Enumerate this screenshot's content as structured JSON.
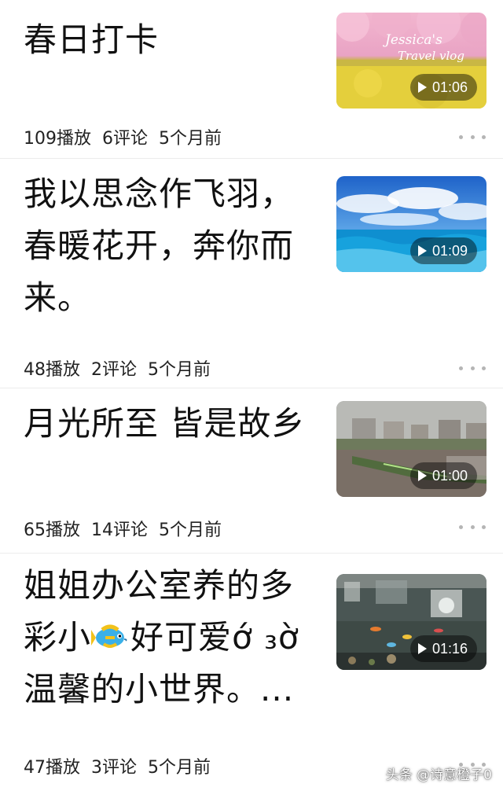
{
  "feed": {
    "items": [
      {
        "title": "春日打卡",
        "duration": "01:06",
        "plays": "109播放",
        "comments": "6评论",
        "time": "5个月前",
        "thumb_caption": "Jessica's Travel vlog"
      },
      {
        "title": "我以思念作飞羽，春暖花开，奔你而来。",
        "duration": "01:09",
        "plays": "48播放",
        "comments": "2评论",
        "time": "5个月前"
      },
      {
        "title": "月光所至 皆是故乡",
        "duration": "01:00",
        "plays": "65播放",
        "comments": "14评论",
        "time": "5个月前"
      },
      {
        "title_part1": "姐姐办公室养的多彩小",
        "title_part2": "好可爱ớ ₃ờ温馨的小世界。...",
        "duration": "01:16",
        "plays": "47播放",
        "comments": "3评论",
        "time": "5个月前"
      }
    ]
  },
  "watermark": "头条 @诗意橙子0",
  "icons": {
    "play": "play-icon",
    "more": "more-dots-icon",
    "fish_emoji": "tropical-fish-icon"
  },
  "colors": {
    "text": "#111111",
    "meta": "#222222",
    "badge_bg": "rgba(0,0,0,0.45)",
    "divider": "#ececec"
  }
}
